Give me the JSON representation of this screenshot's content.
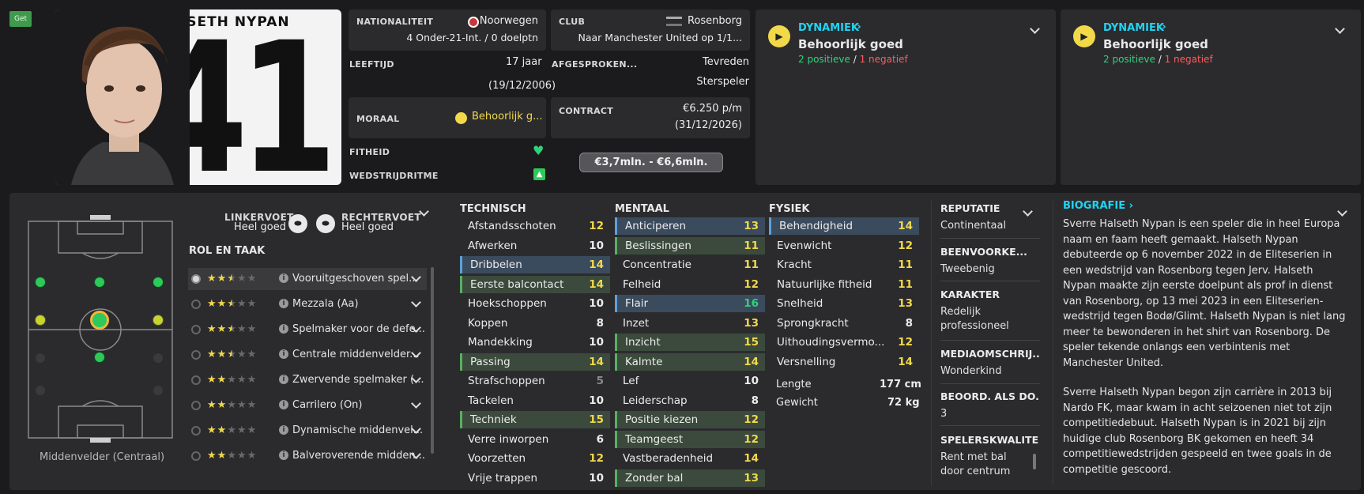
{
  "get_badge": "Get",
  "player": {
    "name": "HALSETH NYPAN",
    "shirt_number": "41"
  },
  "info": {
    "nationality_label": "NATIONALITEIT",
    "nationality_value": "Noorwegen",
    "nationality_caps": "4 Onder-21-Int. / 0 doelptn",
    "club_label": "CLUB",
    "club_value": "Rosenborg",
    "club_transfer": "Naar Manchester United op 1/1...",
    "age_label": "LEEFTIJD",
    "age_value": "17 jaar",
    "dob": "(19/12/2006)",
    "agreed_label": "AFGESPROKEN...",
    "agreed_value": "Tevreden",
    "agreed_role": "Sterspeler",
    "morale_label": "MORAAL",
    "morale_value": "Behoorlijk g...",
    "contract_label": "CONTRACT",
    "contract_wage": "€6.250 p/m",
    "contract_end": "(31/12/2026)",
    "fitness_label": "FITHEID",
    "match_label": "WEDSTRIJDRITME",
    "value_range": "€3,7mln. - €6,6mln."
  },
  "dynamics": [
    {
      "title": "DYNAMIEK",
      "status": "Behoorlijk goed",
      "positive": "2 positieve",
      "sep": "/",
      "negative": "1 negatief"
    },
    {
      "title": "DYNAMIEK",
      "status": "Behoorlijk goed",
      "positive": "2 positieve",
      "sep": "/",
      "negative": "1 negatief"
    }
  ],
  "position_label": "Middenvelder (Centraal)",
  "feet": {
    "left_label": "LINKERVOET",
    "left_value": "Heel goed",
    "right_label": "RECHTERVOET",
    "right_value": "Heel goed"
  },
  "roles_title": "ROL EN TAAK",
  "roles": [
    {
      "name": "Vooruitgeschoven spel...",
      "stars": 2.5
    },
    {
      "name": "Mezzala (Aa)",
      "stars": 2.5
    },
    {
      "name": "Spelmaker voor de defe...",
      "stars": 2.5
    },
    {
      "name": "Centrale middenvelder...",
      "stars": 2.5
    },
    {
      "name": "Zwervende spelmaker (...",
      "stars": 2
    },
    {
      "name": "Carrilero (On)",
      "stars": 2
    },
    {
      "name": "Dynamische middenvel...",
      "stars": 2
    },
    {
      "name": "Balveroverende midden...",
      "stars": 2
    }
  ],
  "technical": {
    "title": "TECHNISCH",
    "rows": [
      {
        "name": "Afstandsschoten",
        "value": "12"
      },
      {
        "name": "Afwerken",
        "value": "10"
      },
      {
        "name": "Dribbelen",
        "value": "14"
      },
      {
        "name": "Eerste balcontact",
        "value": "14"
      },
      {
        "name": "Hoekschoppen",
        "value": "10"
      },
      {
        "name": "Koppen",
        "value": "8"
      },
      {
        "name": "Mandekking",
        "value": "10"
      },
      {
        "name": "Passing",
        "value": "14"
      },
      {
        "name": "Strafschoppen",
        "value": "5"
      },
      {
        "name": "Tackelen",
        "value": "10"
      },
      {
        "name": "Techniek",
        "value": "15"
      },
      {
        "name": "Verre inworpen",
        "value": "6"
      },
      {
        "name": "Voorzetten",
        "value": "12"
      },
      {
        "name": "Vrije trappen",
        "value": "10"
      }
    ]
  },
  "mental": {
    "title": "MENTAAL",
    "rows": [
      {
        "name": "Anticiperen",
        "value": "13"
      },
      {
        "name": "Beslissingen",
        "value": "11"
      },
      {
        "name": "Concentratie",
        "value": "11"
      },
      {
        "name": "Felheid",
        "value": "12"
      },
      {
        "name": "Flair",
        "value": "16"
      },
      {
        "name": "Inzet",
        "value": "13"
      },
      {
        "name": "Inzicht",
        "value": "15"
      },
      {
        "name": "Kalmte",
        "value": "14"
      },
      {
        "name": "Lef",
        "value": "10"
      },
      {
        "name": "Leiderschap",
        "value": "8"
      },
      {
        "name": "Positie kiezen",
        "value": "12"
      },
      {
        "name": "Teamgeest",
        "value": "12"
      },
      {
        "name": "Vastberadenheid",
        "value": "14"
      },
      {
        "name": "Zonder bal",
        "value": "13"
      }
    ]
  },
  "physical": {
    "title": "FYSIEK",
    "rows": [
      {
        "name": "Behendigheid",
        "value": "14"
      },
      {
        "name": "Evenwicht",
        "value": "12"
      },
      {
        "name": "Kracht",
        "value": "11"
      },
      {
        "name": "Natuurlijke fitheid",
        "value": "11"
      },
      {
        "name": "Snelheid",
        "value": "13"
      },
      {
        "name": "Sprongkracht",
        "value": "8"
      },
      {
        "name": "Uithoudingsvermo...",
        "value": "12"
      },
      {
        "name": "Versnelling",
        "value": "14"
      }
    ],
    "length_label": "Lengte",
    "length_value": "177 cm",
    "weight_label": "Gewicht",
    "weight_value": "72 kg"
  },
  "side": {
    "reputation_label": "REPUTATIE",
    "reputation_value": "Continentaal",
    "foot_label": "BEENVOORKE...",
    "foot_value": "Tweebenig",
    "character_label": "KARAKTER",
    "character_value": "Redelijk professioneel",
    "media_label": "MEDIAOMSCHRIJ...",
    "media_value": "Wonderkind",
    "rating_label": "BEOORD. ALS DO...",
    "rating_value": "3",
    "traits_label": "SPELERSKWALITEITEN",
    "traits_value": "Rent met bal door centrum"
  },
  "bio": {
    "title": "BIOGRAFIE",
    "p1": "Sverre Halseth Nypan is een speler die in heel Europa naam en faam heeft gemaakt. Halseth Nypan debuteerde op 6 november 2022 in de Eliteserien in een wedstrijd van Rosenborg tegen Jerv. Halseth Nypan maakte zijn eerste doelpunt als prof in dienst van Rosenborg, op 13 mei 2023 in een Eliteserien-wedstrijd tegen Bodø/Glimt. Halseth Nypan is niet lang meer te bewonderen in het shirt van Rosenborg. De speler tekende onlangs een verbintenis met Manchester United.",
    "p2": "Sverre Halseth Nypan begon zijn carrière in 2013 bij Nardo FK, maar kwam in acht seizoenen niet tot zijn competitiedebuut. Halseth Nypan is in 2021 bij zijn huidige club Rosenborg BK gekomen en heeft 34 competitiewedstrijden gespeeld en twee goals in de competitie gescoord."
  },
  "colors": {
    "accent_yellow": "#f2d94a",
    "accent_cyan": "#22d3f0",
    "positive": "#2fd27a",
    "negative": "#ff5b5b"
  }
}
